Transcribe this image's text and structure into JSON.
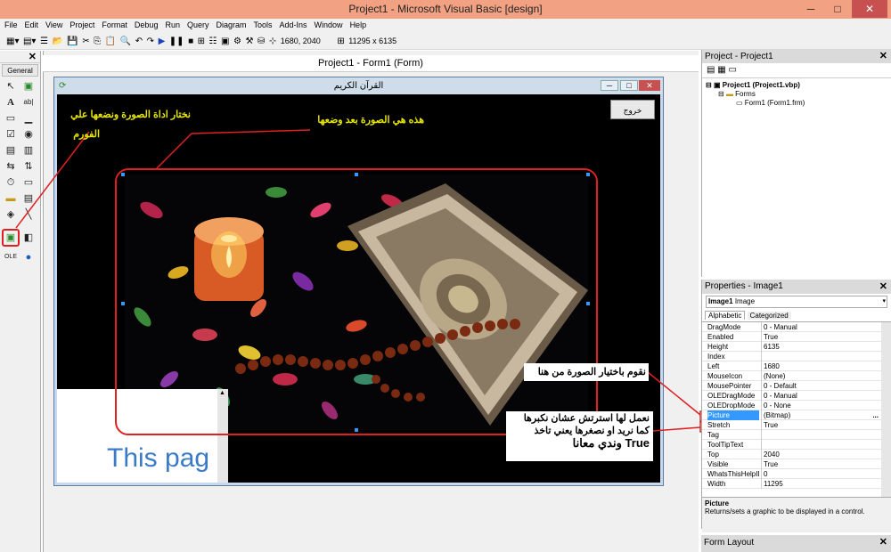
{
  "window": {
    "title": "Project1 - Microsoft Visual Basic [design]",
    "minimize": "─",
    "maximize": "□",
    "close": "✕"
  },
  "menu": [
    "File",
    "Edit",
    "View",
    "Project",
    "Format",
    "Debug",
    "Run",
    "Query",
    "Diagram",
    "Tools",
    "Add-Ins",
    "Window",
    "Help"
  ],
  "toolbar": {
    "position": "1680, 2040",
    "size": "11295 x 6135"
  },
  "toolbox": {
    "label": "General"
  },
  "designer": {
    "title": "Project1 - Form1 (Form)"
  },
  "form": {
    "title": "القرآن الكريم",
    "exit_button": "خروج",
    "this_page_text": "This pag"
  },
  "annotations": {
    "choose_tool": "نختار اداة الصورة ونضعها علي",
    "choose_tool_2": "الفورم",
    "after_place": "هذه هي الصورة بعد وضعها",
    "choose_picture": "نقوم باختيار الصورة من هنا",
    "stretch_1": "نعمل لها استرتش عشان نكبرها",
    "stretch_2": "كما نريد او نصغرها  يعني تاخذ",
    "stretch_3": "True وندي معانا"
  },
  "project": {
    "header": "Project - Project1",
    "root": "Project1 (Project1.vbp)",
    "folder": "Forms",
    "item": "Form1 (Form1.frm)"
  },
  "properties": {
    "header": "Properties - Image1",
    "object": "Image1",
    "object_type": "Image",
    "tab_alpha": "Alphabetic",
    "tab_cat": "Categorized",
    "rows": [
      {
        "name": "DragMode",
        "value": "0 - Manual"
      },
      {
        "name": "Enabled",
        "value": "True"
      },
      {
        "name": "Height",
        "value": "6135"
      },
      {
        "name": "Index",
        "value": ""
      },
      {
        "name": "Left",
        "value": "1680"
      },
      {
        "name": "MouseIcon",
        "value": "(None)"
      },
      {
        "name": "MousePointer",
        "value": "0 - Default"
      },
      {
        "name": "OLEDragMode",
        "value": "0 - Manual"
      },
      {
        "name": "OLEDropMode",
        "value": "0 - None"
      },
      {
        "name": "Picture",
        "value": "(Bitmap)"
      },
      {
        "name": "Stretch",
        "value": "True"
      },
      {
        "name": "Tag",
        "value": ""
      },
      {
        "name": "ToolTipText",
        "value": ""
      },
      {
        "name": "Top",
        "value": "2040"
      },
      {
        "name": "Visible",
        "value": "True"
      },
      {
        "name": "WhatsThisHelpID",
        "value": "0"
      },
      {
        "name": "Width",
        "value": "11295"
      }
    ],
    "desc_title": "Picture",
    "desc_text": "Returns/sets a graphic to be displayed in a control."
  },
  "form_layout": {
    "header": "Form Layout"
  },
  "colors": {
    "title_bar": "#f2a283",
    "annotation_red": "#e02020",
    "annotation_yellow": "#e6e600",
    "selected_row": "#3399ff"
  }
}
